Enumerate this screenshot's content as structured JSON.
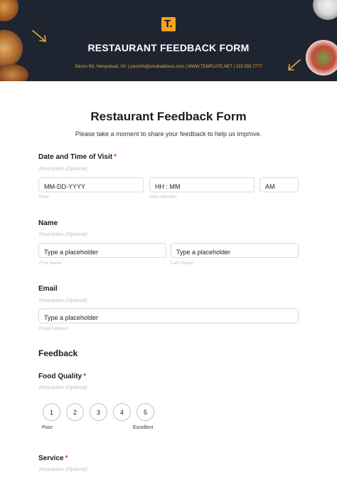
{
  "header": {
    "logo_letter": "T.",
    "title": "RESTAURANT FEEDBACK FORM",
    "contact": "Devon Rd, Hempstead, NY | yourinfo@emailaddress.com | WWW.TEMPLATE.NET | 222 555 7777",
    "colors": {
      "banner": "#1f2530",
      "accent": "#f5a31a"
    }
  },
  "form": {
    "title": "Restaurant Feedback Form",
    "subtitle": "Please take a moment to share your feedback to help us improve.",
    "visit": {
      "label": "Date and Time of Visit",
      "required_mark": "*",
      "description": "Description (Optional)",
      "date_value": "MM-DD-YYYY",
      "date_hint": "Date",
      "time_value": "HH : MM",
      "time_hint": "Hour Minutes",
      "ampm_value": "AM"
    },
    "name": {
      "label": "Name",
      "description": "Description (Optional)",
      "first_placeholder": "Type a placeholder",
      "first_hint": "First Name",
      "last_placeholder": "Type a placeholder",
      "last_hint": "Last Name"
    },
    "email": {
      "label": "Email",
      "description": "Description (Optional)",
      "placeholder": "Type a placeholder",
      "hint": "Email Address"
    },
    "feedback_section": "Feedback",
    "food_quality": {
      "label": "Food Quality",
      "required_mark": "*",
      "description": "Description (Optional)",
      "ratings": [
        "1",
        "2",
        "3",
        "4",
        "5"
      ],
      "low_label": "Poor",
      "high_label": "Excellent"
    },
    "service": {
      "label": "Service",
      "required_mark": "*",
      "description": "Description (Optional)"
    }
  }
}
